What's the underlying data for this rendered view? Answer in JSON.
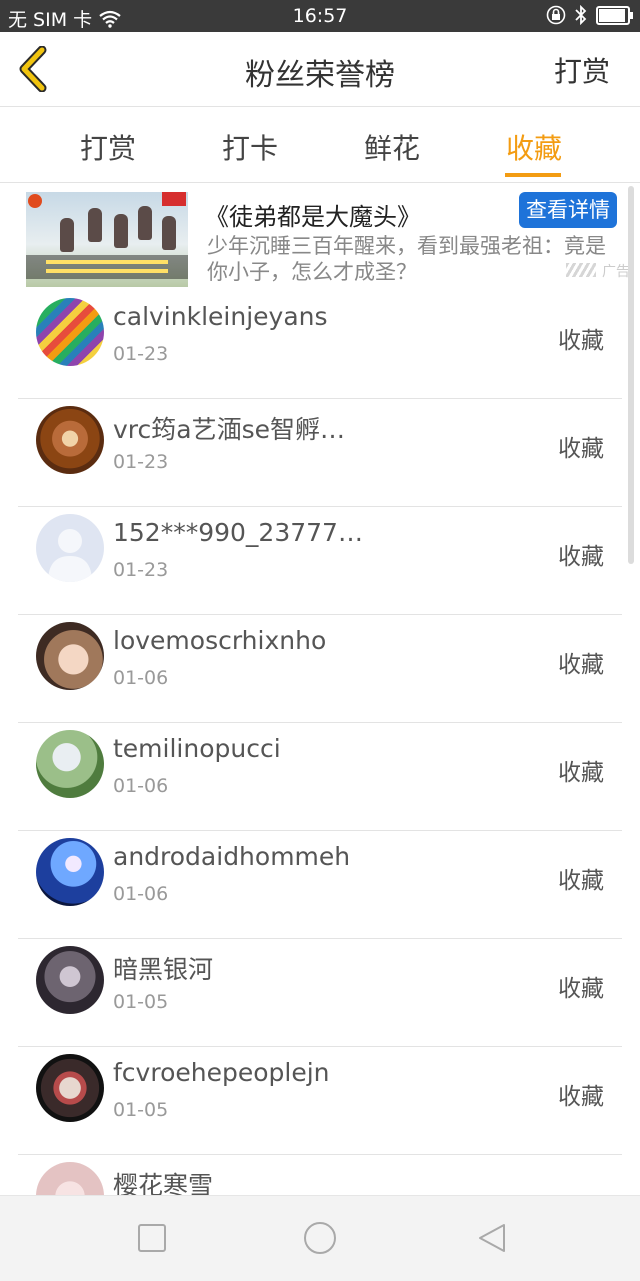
{
  "status_bar": {
    "carrier": "无 SIM 卡",
    "time": "16:57",
    "icons": [
      "wifi-icon",
      "lock-rotation-icon",
      "bluetooth-icon",
      "battery-icon"
    ],
    "battery_level": 0.85
  },
  "header": {
    "title": "粉丝荣誉榜",
    "right_action": "打赏",
    "back_icon": "chevron-left-icon",
    "accent_color": "#f1c40f"
  },
  "tabs": [
    {
      "label": "打赏",
      "active": false
    },
    {
      "label": "打卡",
      "active": false
    },
    {
      "label": "鲜花",
      "active": false
    },
    {
      "label": "收藏",
      "active": true
    }
  ],
  "tab_accent_color": "#f39c12",
  "ad": {
    "title": "《徒弟都是大魔头》",
    "button_label": "查看详情",
    "description": "少年沉睡三百年醒来，看到最强老祖：竟是你小子，怎么才成圣？",
    "tag": "广告"
  },
  "list": {
    "items": [
      {
        "name": "calvinkleinjeyans",
        "date": "01-23",
        "action": "收藏",
        "avatar": "colored-pencils"
      },
      {
        "name": "vrc筠a艺湎se智孵…",
        "date": "01-23",
        "action": "收藏",
        "avatar": "latte-art"
      },
      {
        "name": "152***990_23777…",
        "date": "01-23",
        "action": "收藏",
        "avatar": "default-person"
      },
      {
        "name": "lovemoscrhixnho",
        "date": "01-06",
        "action": "收藏",
        "avatar": "portrait-girl"
      },
      {
        "name": "temilinopucci",
        "date": "01-06",
        "action": "收藏",
        "avatar": "anime-characters"
      },
      {
        "name": "androdaidhommeh",
        "date": "01-06",
        "action": "收藏",
        "avatar": "blue-heart"
      },
      {
        "name": "暗黑银河",
        "date": "01-05",
        "action": "收藏",
        "avatar": "dark-figure"
      },
      {
        "name": "fcvroehepeoplejn",
        "date": "01-05",
        "action": "收藏",
        "avatar": "zombie-face"
      },
      {
        "name": "樱花寒雪",
        "date": "",
        "action": "",
        "avatar": "pink-blur"
      }
    ]
  },
  "nav_bar": {
    "icons": [
      "recent-apps-icon",
      "home-icon",
      "back-triangle-icon"
    ]
  }
}
